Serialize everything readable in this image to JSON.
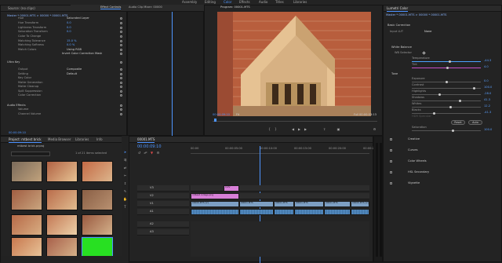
{
  "workspaces": [
    "Assembly",
    "Editing",
    "Color",
    "Effects",
    "Audio",
    "Titles",
    "Libraries"
  ],
  "active_workspace": "Color",
  "source_panel": {
    "tabs": [
      "Source: (no clips)",
      "Lumetri Scopes",
      "Effect Controls",
      "Audio Clip Mixer: 00000"
    ],
    "clip_path": "Master * 00001.MTS  >  00000 * 00001.MTS",
    "rows": [
      {
        "label": "Hue",
        "value": "Saturated Layer"
      },
      {
        "label": "Hue Transform",
        "value": "0.0"
      },
      {
        "label": "Lightness Transform",
        "value": "0.0"
      },
      {
        "label": "Saturation Transform",
        "value": "0.0"
      },
      {
        "label": "Color To Change",
        "value": ""
      },
      {
        "label": "Matching Tolerance",
        "value": "15.0 %"
      },
      {
        "label": "Matching Softness",
        "value": "0.0 %"
      },
      {
        "label": "Match Colors",
        "value": "Using RGB"
      },
      {
        "label": "",
        "value": "Invert Color Correction Mask"
      },
      {
        "label": "Ultra Key",
        "value": ""
      },
      {
        "label": "Output",
        "value": "Composite"
      },
      {
        "label": "Setting",
        "value": "Default"
      },
      {
        "label": "Key Color",
        "value": ""
      },
      {
        "label": "Matte Generation",
        "value": ""
      },
      {
        "label": "Matte Cleanup",
        "value": ""
      },
      {
        "label": "Spill Suppression",
        "value": ""
      },
      {
        "label": "Color Correction",
        "value": ""
      },
      {
        "label": "Audio Effects",
        "value": ""
      },
      {
        "label": "Volume",
        "value": ""
      },
      {
        "label": "Channel Volume",
        "value": ""
      }
    ],
    "timecode": "00:00:09:10"
  },
  "program_panel": {
    "title": "Program: 00001.MTS",
    "timecode": "00:00:09:10",
    "fit": "Fit",
    "quality": "Full",
    "duration": "00:00:03:13"
  },
  "lumetri": {
    "tabs": [
      "Lumetri Color"
    ],
    "clip_path": "Master * 00001.MTS  >  00000 * 00001.MTS",
    "basic_correction": "Basic Correction",
    "input_lut": "Input LUT",
    "input_lut_value": "None",
    "white_balance": "White Balance",
    "wb_selector": "WB Selector",
    "temperature_label": "Temperature",
    "temperature": "-44.3",
    "tint_label": "Tint",
    "tint": "4.0",
    "tone": "Tone",
    "exposure_label": "Exposure",
    "exposure": "0.0",
    "contrast_label": "Contrast",
    "contrast": "100.0",
    "highlights_label": "Highlights",
    "highlights": "-28.0",
    "shadows_label": "Shadows",
    "shadows": "41.3",
    "whites_label": "Whites",
    "whites": "12.2",
    "blacks_label": "Blacks",
    "blacks": "-41.3",
    "hdr_label": "HDR Specular",
    "reset": "Reset",
    "auto": "Auto",
    "saturation_label": "Saturation",
    "saturation": "100.0",
    "sections": [
      "Creative",
      "Curves",
      "Color Wheels",
      "HSL Secondary",
      "Vignette"
    ],
    "sliders": {
      "temperature": 0.55,
      "tint": 0.52,
      "exposure": 0.5,
      "contrast": 0.9,
      "highlights": 0.4,
      "shadows": 0.7,
      "whites": 0.56,
      "blacks": 0.32,
      "saturation": 0.6
    }
  },
  "project_panel": {
    "tabs": [
      "Project: mtbest brick",
      "Media Browser",
      "Libraries",
      "Info"
    ],
    "project_file": "mtbest brick.prproj",
    "items_selected": "1 of 21 items selected"
  },
  "timeline": {
    "tab": "00001.MTS",
    "timecode": "00:00:09:10",
    "ruler": [
      "00:00",
      "00:00:05:00",
      "00:00:10:00",
      "00:00:15:00",
      "00:00:20:00",
      "00:00:25:00"
    ],
    "tracks": [
      "V3",
      "V2",
      "V1",
      "A1",
      "A2",
      "A3"
    ],
    "v3_label": "ColV",
    "v2_clip": "mtbest collage.png",
    "v1_clips": [
      "00000.MTS [V]",
      "00001.MTS",
      "00001.MTS",
      "00001.MTS",
      "00001.MTS",
      "00000.MTS [V]"
    ],
    "audio_names": [
      "Audio 1",
      "Audio 2",
      "Audio 3"
    ]
  },
  "colors": {
    "accent": "#4e95ff",
    "video_clip": "#7d9fc3",
    "audio_clip": "#3b6fa0",
    "pink_clip": "#d77fd7",
    "green": "#28e022"
  }
}
